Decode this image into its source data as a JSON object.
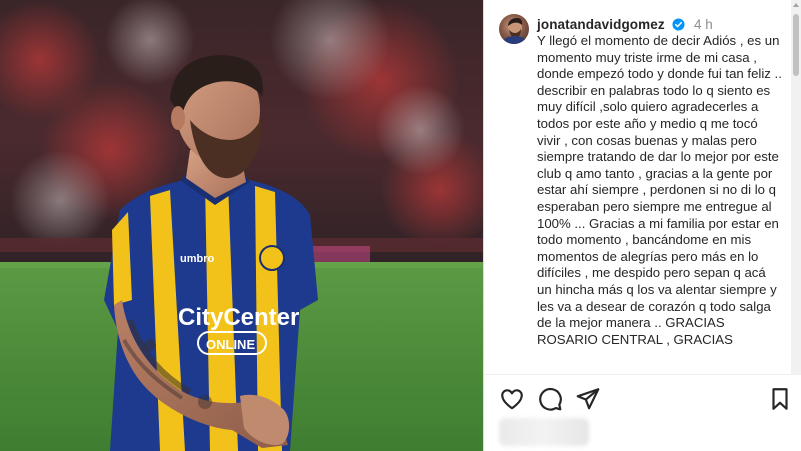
{
  "post": {
    "username": "jonatandavidgomez",
    "verified": true,
    "time": "4 h",
    "caption": "Y llegó el momento de decir Adiós , es un momento muy triste irme de mi casa , donde empezó todo y donde fui tan feliz .. describir en palabras todo lo q siento es muy difícil ,solo quiero agradecerles a todos por este año y medio q me tocó vivir , con cosas buenas y malas pero siempre tratando de dar lo mejor por este club q amo tanto , gracias a la gente por estar ahí siempre , perdonen si no di lo q esperaban pero siempre me entregue al 100% ... Gracias a mi familia por estar en todo momento , bancándome en mis momentos de alegrías pero más en lo difíciles , me despido pero sepan q acá un hincha más q los va alentar siempre y les va a desear de corazón q todo salga de la mejor manera .. GRACIAS ROSARIO CENTRAL , GRACIAS"
  },
  "photo": {
    "jersey_brand": "umbro",
    "sponsor_line1": "CityCenter",
    "sponsor_line2": "ONLINE"
  },
  "actions": {
    "icons": [
      "heart-icon",
      "comment-icon",
      "share-icon",
      "bookmark-icon"
    ]
  },
  "colors": {
    "jersey_blue": "#1d3a8f",
    "jersey_yellow": "#f2c21a",
    "pitch_green": "#4d8f3a",
    "verified_blue": "#0095f6",
    "text": "#262626",
    "muted": "#8e8e8e"
  }
}
